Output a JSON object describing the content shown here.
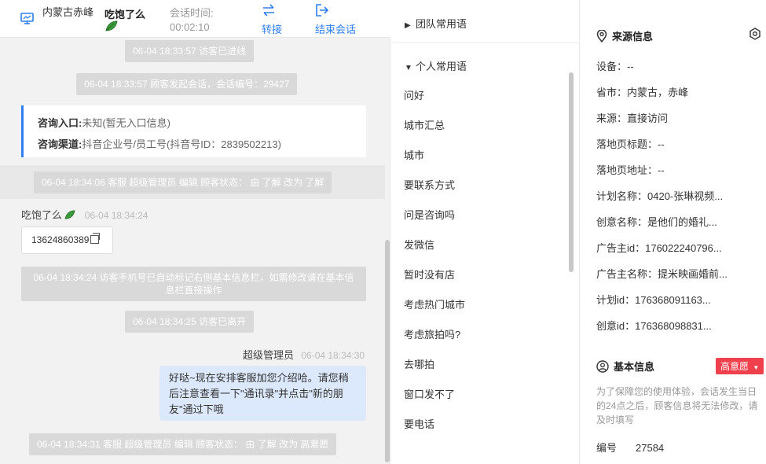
{
  "header": {
    "location": "内蒙古赤峰",
    "visitor_name": "吃饱了么",
    "session_time_label": "会话时间:",
    "session_time": "00:02:10",
    "transfer_label": "转接",
    "end_label": "结束会话",
    "accent": "#2f7ff0"
  },
  "chat": {
    "sys1": "06-04 18:33:57 访客已进线",
    "sys2": "06-04 18:33:57 顾客发起会话，会话编号：29427",
    "info_card": {
      "entry_label": "咨询入口:",
      "entry_value": "未知(暂无入口信息)",
      "channel_label": "咨询渠道:",
      "channel_value": "抖音企业号/员工号(抖音号ID：2839502213)"
    },
    "sys3": "06-04 18:34:06 客服 超级管理员 编辑 顾客状态： 由 了解 改为 了解",
    "visitor_msg": {
      "name": "吃饱了么",
      "time": "06-04 18:34:24",
      "text": "13624860389"
    },
    "sys4": "06-04 18:34:24 访客手机号已自动标记右侧基本信息栏，如需修改请在基本信息栏直接操作",
    "sys5": "06-04 18:34:25 访客已离开",
    "agent_msg": {
      "name": "超级管理员",
      "time": "06-04 18:34:30",
      "text": "好哒~现在安排客服加您介绍哈。请您稍后注意查看一下\"通讯录\"并点击\"新的朋友\"通过下哦"
    },
    "sys6": "06-04 18:34:31 客服 超级管理员 编辑 顾客状态： 由 了解 改为 高意愿"
  },
  "phrases": {
    "team_group": "团队常用语",
    "personal_group": "个人常用语",
    "items": [
      "问好",
      "城市汇总",
      "城市",
      "要联系方式",
      "问是咨询吗",
      "发微信",
      "暂时没有店",
      "考虑热门城市",
      "考虑旅拍吗?",
      "去哪拍",
      "窗口发不了",
      "要电话"
    ]
  },
  "info": {
    "source_title": "来源信息",
    "fields": [
      "设备：--",
      "省市：内蒙古，赤峰",
      "来源：直接访问",
      "落地页标题：--",
      "落地页地址：--",
      "计划名称：0420-张琳视频...",
      "创意名称：是他们的婚礼...",
      "广告主id：176022240796...",
      "广告主名称：提米映画婚前...",
      "计划id：176368091163...",
      "创意id：176368098831..."
    ],
    "basic_title": "基本信息",
    "intent_badge": "高意愿",
    "intent_color": "#f0404d",
    "notice": "为了保障您的使用体验，会话发生当日的24点之后，顾客信息将无法修改，请及时填写",
    "serial_label": "编号",
    "serial_value": "27584"
  }
}
